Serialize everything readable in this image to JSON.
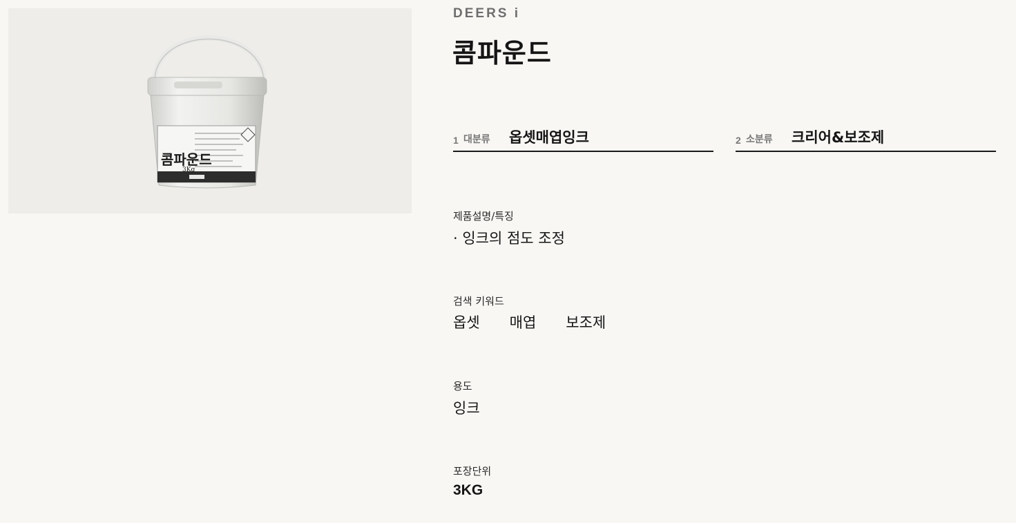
{
  "brand": "DEERS i",
  "product": {
    "title": "콤파운드",
    "image_alt": "콤파운드 3Kg 용기",
    "label_name": "콤파운드",
    "label_weight": "3Kg"
  },
  "categories": [
    {
      "num": "1",
      "label": "대분류",
      "value": "옵셋매엽잉크"
    },
    {
      "num": "2",
      "label": "소분류",
      "value": "크리어&보조제"
    }
  ],
  "details": {
    "description_label": "제품설명/특징",
    "description_value": "· 잉크의 점도 조정",
    "keywords_label": "검색 키워드",
    "keywords": [
      "옵셋",
      "매엽",
      "보조제"
    ],
    "usage_label": "용도",
    "usage_value": "잉크",
    "package_label": "포장단위",
    "package_value": "3KG"
  }
}
